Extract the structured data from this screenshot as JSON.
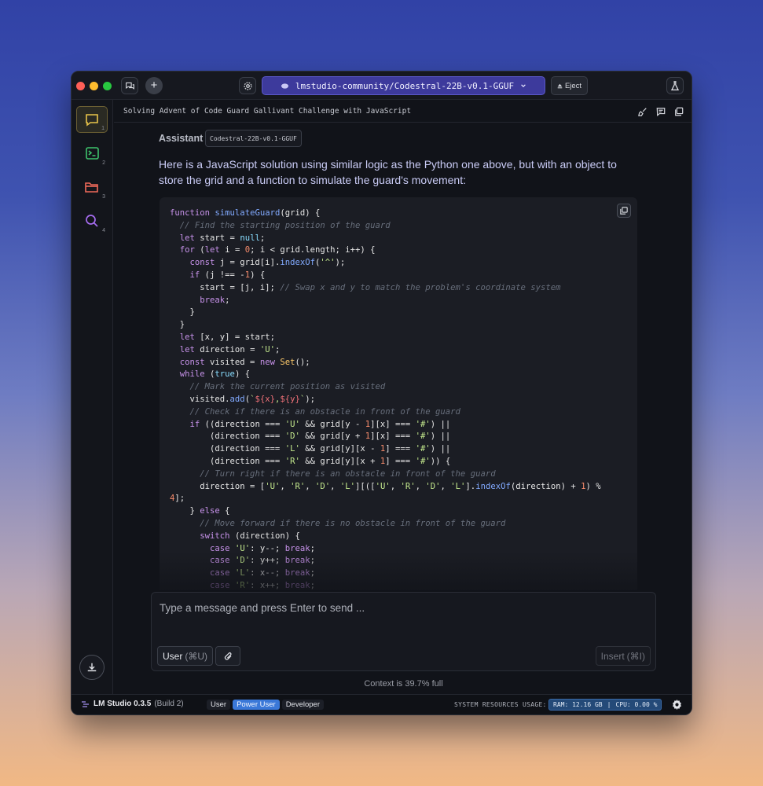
{
  "topbar": {
    "model_name": "lmstudio-community/Codestral-22B-v0.1-GGUF",
    "eject_label": "Eject"
  },
  "sidebar": {
    "items": [
      {
        "icon": "chat-icon",
        "number": "1",
        "active": true
      },
      {
        "icon": "terminal-icon",
        "number": "2",
        "active": false
      },
      {
        "icon": "folder-icon",
        "number": "3",
        "active": false
      },
      {
        "icon": "search-icon",
        "number": "4",
        "active": false
      }
    ]
  },
  "chat": {
    "title": "Solving Advent of Code Guard Gallivant Challenge with JavaScript",
    "assistant_label": "Assistant",
    "model_badge": "Codestral-22B-v0.1-GGUF",
    "message": "Here is a JavaScript solution using similar logic as the Python one above, but with an object to store the grid and a function to simulate the guard's movement:"
  },
  "composer": {
    "placeholder": "Type a message and press Enter to send ...",
    "role_label": "User",
    "role_shortcut": "(⌘U)",
    "insert_label": "Insert",
    "insert_shortcut": "(⌘I)"
  },
  "context": {
    "text": "Context is 39.7% full"
  },
  "statusbar": {
    "app_name": "LM Studio 0.3.5",
    "build": "(Build 2)",
    "modes": [
      "User",
      "Power User",
      "Developer"
    ],
    "active_mode": "Power User",
    "resources_label": "SYSTEM RESOURCES USAGE:",
    "ram": "RAM: 12.16 GB",
    "separator": "|",
    "cpu": "CPU: 0.00 %"
  },
  "colors": {
    "accent": "#3d3a9c",
    "active_mode": "#3a78d8",
    "resources_pill": "#244a78"
  }
}
